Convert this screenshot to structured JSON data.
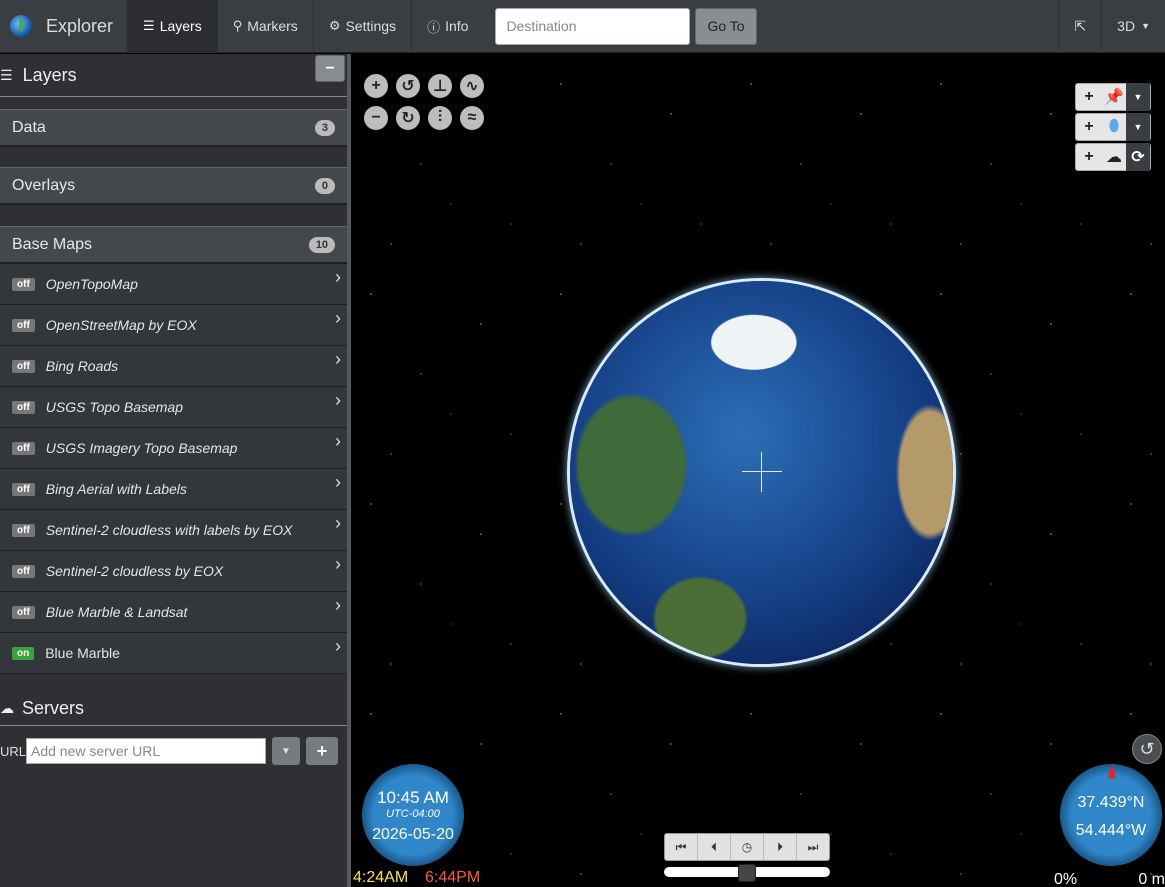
{
  "navbar": {
    "brand": "Explorer",
    "tabs": [
      {
        "label": "Layers",
        "icon": "list-icon"
      },
      {
        "label": "Markers",
        "icon": "map-marker-icon"
      },
      {
        "label": "Settings",
        "icon": "gear-icon"
      },
      {
        "label": "Info",
        "icon": "info-icon"
      }
    ],
    "destination_placeholder": "Destination",
    "go_label": "Go To",
    "mode_label": "3D"
  },
  "sidebar": {
    "title": "Layers",
    "sections": [
      {
        "label": "Data",
        "count": "3"
      },
      {
        "label": "Overlays",
        "count": "0"
      },
      {
        "label": "Base Maps",
        "count": "10"
      }
    ],
    "base_maps": [
      {
        "state": "off",
        "name": "OpenTopoMap"
      },
      {
        "state": "off",
        "name": "OpenStreetMap by EOX"
      },
      {
        "state": "off",
        "name": "Bing Roads"
      },
      {
        "state": "off",
        "name": "USGS Topo Basemap"
      },
      {
        "state": "off",
        "name": "USGS Imagery Topo Basemap"
      },
      {
        "state": "off",
        "name": "Bing Aerial with Labels"
      },
      {
        "state": "off",
        "name": "Sentinel-2 cloudless with labels by EOX"
      },
      {
        "state": "off",
        "name": "Sentinel-2 cloudless by EOX"
      },
      {
        "state": "off",
        "name": "Blue Marble & Landsat"
      },
      {
        "state": "on",
        "name": "Blue Marble"
      }
    ],
    "servers": {
      "title": "Servers",
      "url_label": "URL",
      "url_placeholder": "Add new server URL"
    }
  },
  "map": {
    "clock": {
      "time": "10:45 AM",
      "tz": "UTC-04:00",
      "date": "2026-05-20"
    },
    "sunrise": "4:24AM",
    "sunset": "6:44PM",
    "compass": {
      "lat": "37.439°N",
      "lng": "54.444°W"
    },
    "percent": "0%",
    "distance": "0 m"
  },
  "colors": {
    "on_state": "#3aa33a",
    "off_state": "#777777",
    "sunrise": "#ffe24a",
    "sunset": "#ff5b3b"
  }
}
